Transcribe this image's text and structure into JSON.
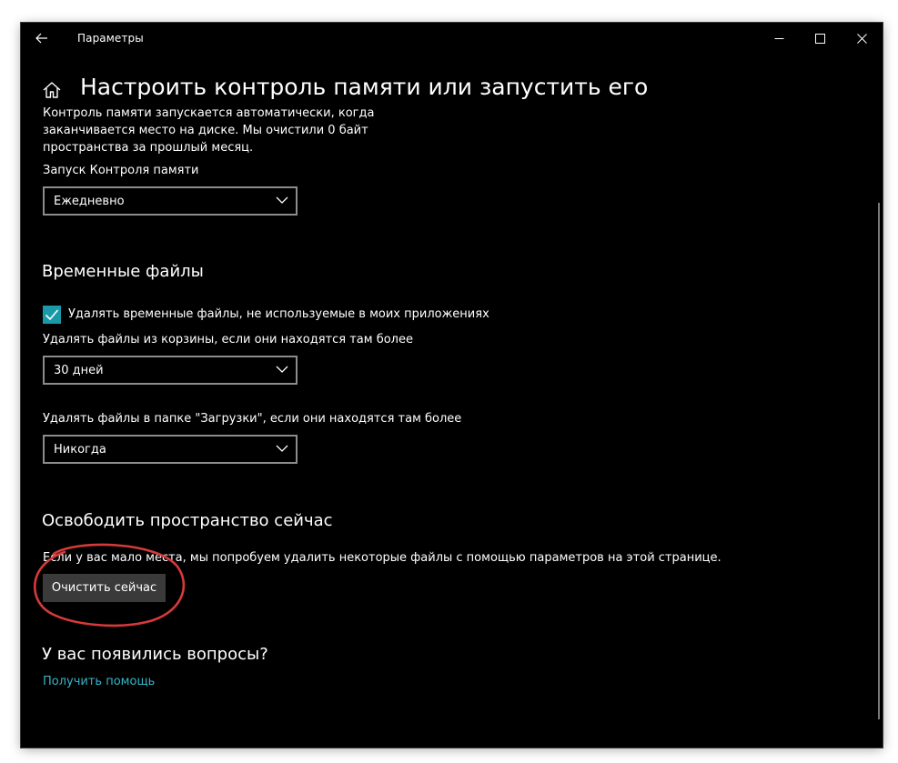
{
  "window": {
    "title": "Параметры",
    "back_icon": "back-arrow-icon",
    "controls": [
      "minimize-icon",
      "maximize-icon",
      "close-icon"
    ]
  },
  "header": {
    "home_icon": "home-icon",
    "title": "Настроить контроль памяти или запустить его"
  },
  "storage_sense": {
    "description": "Контроль памяти запускается автоматически, когда заканчивается место на диске. Мы очистили 0 байт пространства за прошлый месяц.",
    "run_label": "Запуск Контроля памяти",
    "run_value": "Ежедневно"
  },
  "temp_files": {
    "title": "Временные файлы",
    "delete_temp_label": "Удалять временные файлы, не используемые в моих приложениях",
    "delete_temp_checked": true,
    "recycle_label": "Удалять файлы из корзины, если они находятся там более",
    "recycle_value": "30 дней",
    "downloads_label": "Удалять файлы в папке \"Загрузки\", если они находятся там более",
    "downloads_value": "Никогда"
  },
  "free_now": {
    "title": "Освободить пространство сейчас",
    "description": "Если у вас мало места, мы попробуем удалить некоторые файлы с помощью параметров на этой странице.",
    "button": "Очистить сейчас"
  },
  "help": {
    "title": "У вас появились вопросы?",
    "link": "Получить помощь"
  },
  "colors": {
    "background": "#000000",
    "accent": "#1a9aa8",
    "link": "#35b5c8",
    "annotation": "#d63a3a"
  }
}
